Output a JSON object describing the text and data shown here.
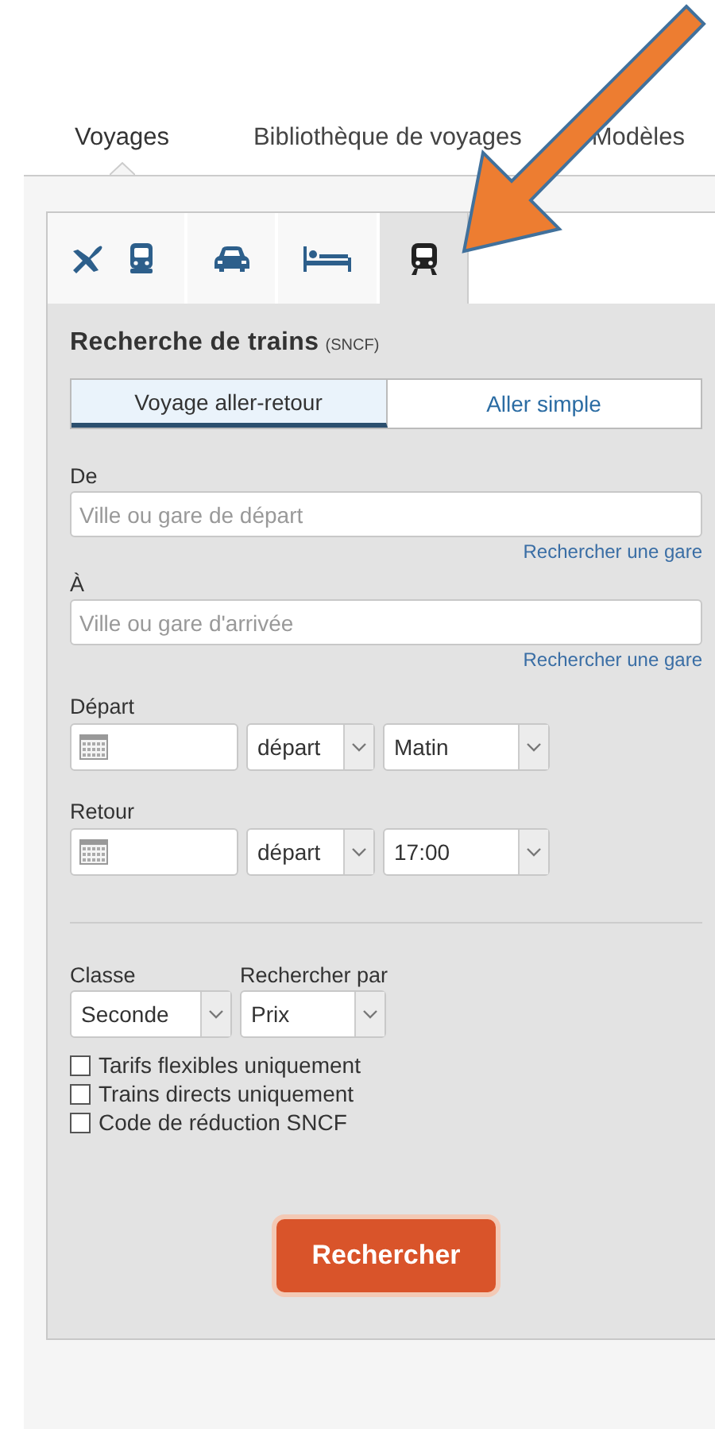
{
  "nav_tabs": [
    {
      "label": "Voyages",
      "selected": true
    },
    {
      "label": "Bibliothèque de voyages",
      "selected": false
    },
    {
      "label": "Modèles",
      "selected": false
    }
  ],
  "mode_tabs": [
    {
      "kind": "flight_train",
      "selected": false
    },
    {
      "kind": "car",
      "selected": false
    },
    {
      "kind": "hotel",
      "selected": false
    },
    {
      "kind": "train",
      "selected": true
    }
  ],
  "title": "Recherche de trains",
  "title_note": "(SNCF)",
  "trip_types": [
    {
      "label": "Voyage aller-retour",
      "selected": true
    },
    {
      "label": "Aller simple",
      "selected": false
    }
  ],
  "stations": [
    {
      "label": "De",
      "placeholder": "Ville ou gare de départ",
      "link": "Rechercher une gare"
    },
    {
      "label": "À",
      "placeholder": "Ville ou gare d'arrivée",
      "link": "Rechercher une gare"
    }
  ],
  "dates": [
    {
      "label": "Départ",
      "mode": "départ",
      "time": "Matin"
    },
    {
      "label": "Retour",
      "mode": "départ",
      "time": "17:00"
    }
  ],
  "options": [
    {
      "label": "Classe",
      "value": "Seconde"
    },
    {
      "label": "Rechercher par",
      "value": "Prix"
    }
  ],
  "checkboxes": [
    {
      "label": "Tarifs flexibles uniquement",
      "checked": false
    },
    {
      "label": "Trains directs uniquement",
      "checked": false
    },
    {
      "label": "Code de réduction SNCF",
      "checked": false
    }
  ],
  "search_button": "Rechercher",
  "annotation": {
    "kind": "arrow"
  }
}
